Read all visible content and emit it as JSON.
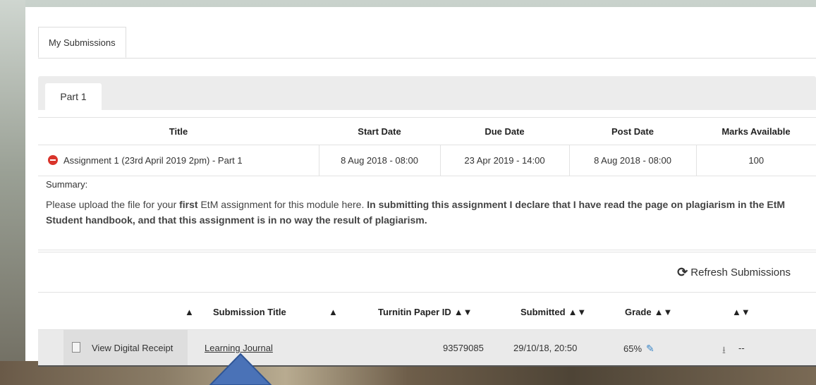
{
  "tabs": {
    "my_submissions": "My Submissions",
    "part": "Part 1"
  },
  "assignment_table": {
    "headers": [
      "Title",
      "Start Date",
      "Due Date",
      "Post Date",
      "Marks Available"
    ],
    "row": {
      "title": "Assignment 1 (23rd April 2019 2pm) - Part 1",
      "start_date": "8 Aug 2018 - 08:00",
      "due_date": "23 Apr 2019 - 14:00",
      "post_date": "8 Aug 2018 - 08:00",
      "marks": "100"
    }
  },
  "summary": {
    "label": "Summary:",
    "text_1": "Please upload the file for your ",
    "bold_1": "first",
    "text_2": " EtM assignment for this module here. ",
    "bold_2": "In submitting this assignment I declare that I have read the page on plagiarism in the EtM Student handbook, and that this assignment is in no way the result of plagiarism."
  },
  "refresh": {
    "label": "Refresh Submissions",
    "icon": "refresh-icon"
  },
  "submissions": {
    "headers": {
      "title": "Submission Title",
      "paper_id": "Turnitin Paper ID",
      "submitted": "Submitted",
      "grade": "Grade"
    },
    "row": {
      "receipt": "View Digital Receipt",
      "title": "Learning Journal",
      "paper_id": "93579085",
      "submitted": "29/10/18, 20:50",
      "grade": "65%",
      "dash": "--"
    }
  },
  "colors": {
    "accent_blue": "#4a7fc1",
    "remove_red": "#d9342b"
  }
}
